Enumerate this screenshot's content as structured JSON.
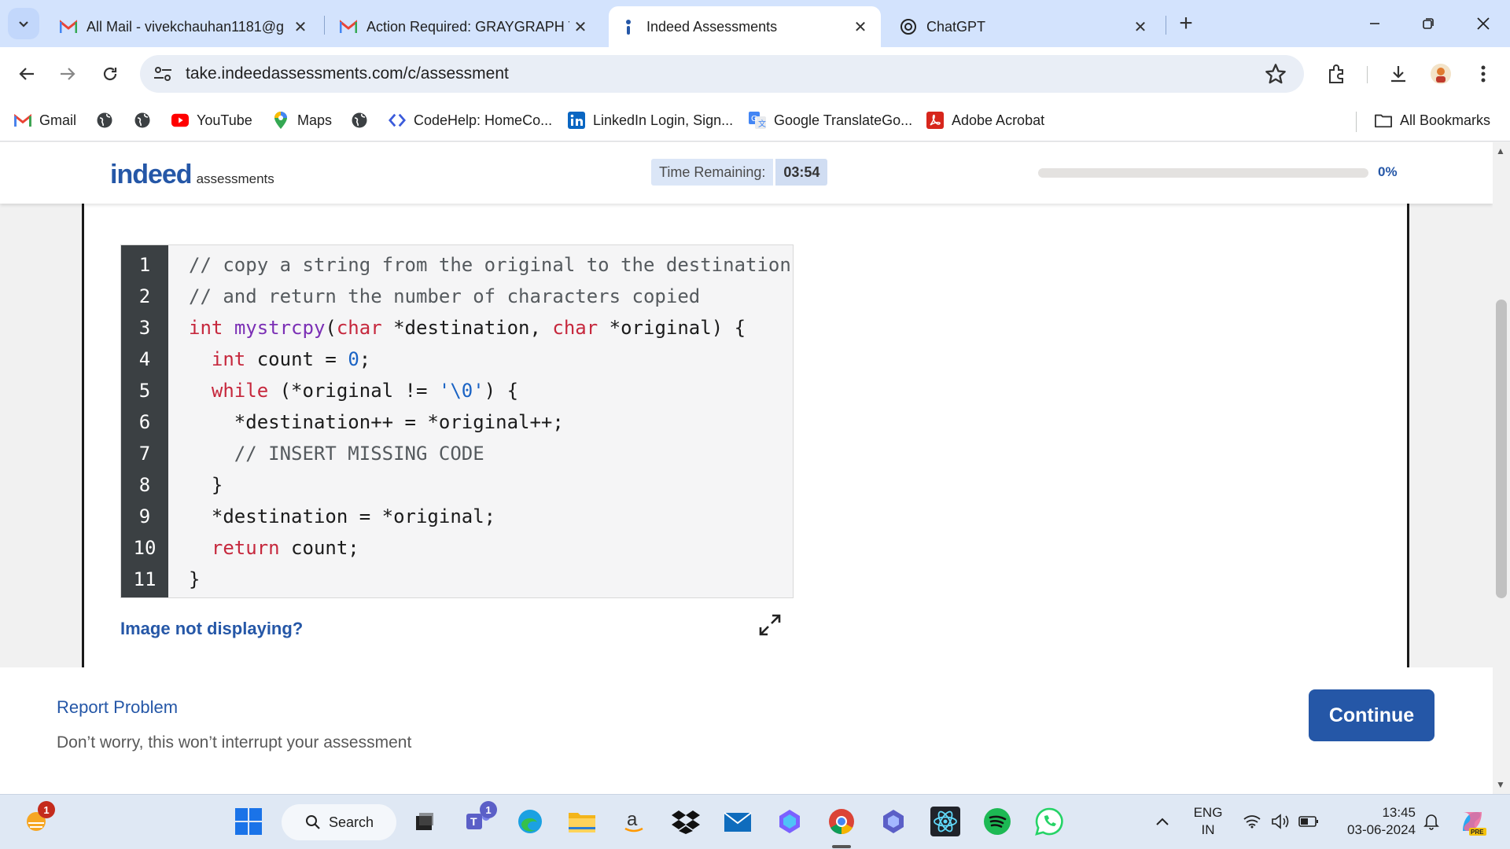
{
  "browser": {
    "tabs": [
      {
        "title": "All Mail - vivekchauhan1181@g",
        "favicon": "gmail-icon",
        "active": false
      },
      {
        "title": "Action Required: GRAYGRAPH T",
        "favicon": "gmail-icon",
        "active": false
      },
      {
        "title": "Indeed Assessments",
        "favicon": "indeed-icon",
        "active": true
      },
      {
        "title": "ChatGPT",
        "favicon": "chatgpt-icon",
        "active": false
      }
    ],
    "url": "take.indeedassessments.com/c/assessment",
    "bookmarks": [
      {
        "label": "Gmail",
        "icon": "gmail-icon"
      },
      {
        "label": "",
        "icon": "globe-icon"
      },
      {
        "label": "",
        "icon": "globe-icon"
      },
      {
        "label": "YouTube",
        "icon": "youtube-icon"
      },
      {
        "label": "Maps",
        "icon": "maps-icon"
      },
      {
        "label": "",
        "icon": "globe-icon"
      },
      {
        "label": "CodeHelp: HomeCo...",
        "icon": "codehelp-icon"
      },
      {
        "label": "LinkedIn Login, Sign...",
        "icon": "linkedin-icon"
      },
      {
        "label": "Google TranslateGo...",
        "icon": "translate-icon"
      },
      {
        "label": "Adobe Acrobat",
        "icon": "acrobat-icon"
      }
    ],
    "all_bookmarks": "All Bookmarks"
  },
  "assessment": {
    "logo_word": "indeed",
    "logo_suffix": "assessments",
    "time_label": "Time Remaining:",
    "time_value": "03:54",
    "progress_fraction": 0.0,
    "progress_label": "0%",
    "image_link": "Image not displaying?",
    "report_problem": "Report Problem",
    "report_note": "Don’t worry, this won’t interrupt your assessment",
    "continue_label": "Continue",
    "code_lines": [
      {
        "n": "1",
        "html": "<span class=\"cm\">// copy a string from the original to the destination</span>"
      },
      {
        "n": "2",
        "html": "<span class=\"cm\">// and return the number of characters copied</span>"
      },
      {
        "n": "3",
        "html": "<span class=\"kw\">int</span> <span class=\"fn\">mystrcpy</span>(<span class=\"kw\">char</span> *destination, <span class=\"kw\">char</span> *original) {"
      },
      {
        "n": "4",
        "html": "  <span class=\"kw\">int</span> count = <span class=\"num\">0</span>;"
      },
      {
        "n": "5",
        "html": "  <span class=\"kw\">while</span> (*original != <span class=\"str\">'\\0'</span>) {"
      },
      {
        "n": "6",
        "html": "    *destination++ = *original++;"
      },
      {
        "n": "7",
        "html": "    <span class=\"cm\">// INSERT MISSING CODE</span>"
      },
      {
        "n": "8",
        "html": "  }"
      },
      {
        "n": "9",
        "html": "  *destination = *original;"
      },
      {
        "n": "10",
        "html": "  <span class=\"kw\">return</span> count;"
      },
      {
        "n": "11",
        "html": "}"
      }
    ]
  },
  "taskbar": {
    "search_label": "Search",
    "weather_badge": "1",
    "teams_badge": "1",
    "lang_line1": "ENG",
    "lang_line2": "IN",
    "time": "13:45",
    "date": "03-06-2024"
  },
  "colors": {
    "accent": "#2557a7",
    "tabstrip": "#d3e3fd",
    "gutter": "#3b4043"
  }
}
